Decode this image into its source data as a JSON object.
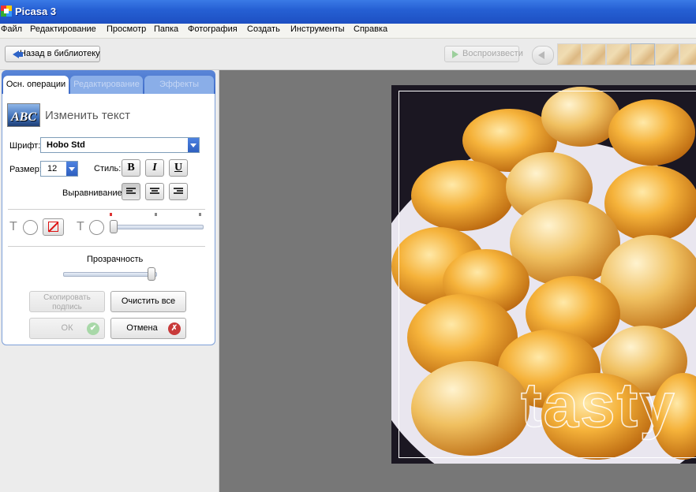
{
  "window": {
    "title": "Picasa 3"
  },
  "menu": [
    "Файл",
    "Редактирование",
    "Просмотр",
    "Папка",
    "Фотография",
    "Создать",
    "Инструменты",
    "Справка"
  ],
  "toolbar": {
    "back_label": "Назад в библиотеку",
    "play_label": "Воспроизвести"
  },
  "tabs": [
    {
      "label": "Осн. операции",
      "active": true
    },
    {
      "label": "Редактирование",
      "active": false
    },
    {
      "label": "Эффекты",
      "active": false
    }
  ],
  "panel": {
    "icon_text": "ABC",
    "title": "Изменить текст",
    "font_label": "Шрифт:",
    "font_value": "Hobo Std",
    "size_label": "Размер:",
    "size_value": "12",
    "style_label": "Стиль:",
    "bold": "B",
    "italic": "I",
    "underline": "U",
    "align_label": "Выравнивание:",
    "t_glyph": "T",
    "transparency_label": "Прозрачность",
    "copy_label_1": "Скопировать",
    "copy_label_2": "подпись",
    "clear_label": "Очистить все",
    "ok_label": "ОК",
    "cancel_label": "Отмена",
    "ok_icon": "✔",
    "cancel_icon": "✗"
  },
  "photo": {
    "watermark_text": "tasty"
  },
  "colors": {
    "accent": "#2d63c7",
    "tab_bar": "#4f7bd2",
    "canvas": "#777777"
  }
}
